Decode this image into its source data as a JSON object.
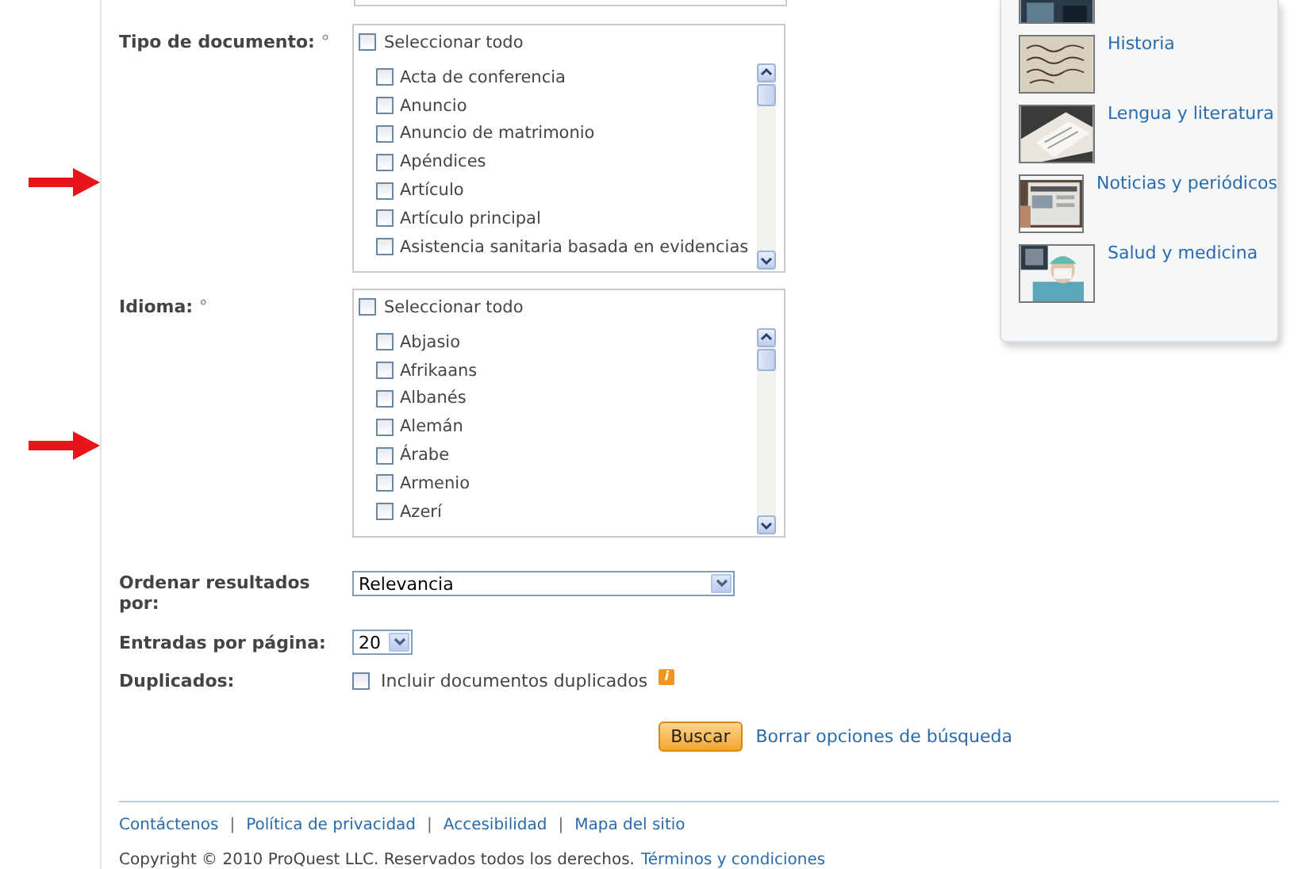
{
  "document_type": {
    "label": "Tipo de documento:",
    "marker": "°",
    "select_all": {
      "label": "Seleccionar todo",
      "checked": false
    },
    "options": [
      {
        "label": "Acta de conferencia",
        "checked": false
      },
      {
        "label": "Anuncio",
        "checked": false
      },
      {
        "label": "Anuncio de matrimonio",
        "checked": false
      },
      {
        "label": "Apéndices",
        "checked": false
      },
      {
        "label": "Artículo",
        "checked": false
      },
      {
        "label": "Artículo principal",
        "checked": false
      },
      {
        "label": "Asistencia sanitaria basada en evidencias",
        "checked": false
      }
    ]
  },
  "language": {
    "label": "Idioma:",
    "marker": "°",
    "select_all": {
      "label": "Seleccionar todo",
      "checked": false
    },
    "options": [
      {
        "label": "Abjasio",
        "checked": false
      },
      {
        "label": "Afrikaans",
        "checked": false
      },
      {
        "label": "Albanés",
        "checked": false
      },
      {
        "label": "Alemán",
        "checked": false
      },
      {
        "label": "Árabe",
        "checked": false
      },
      {
        "label": "Armenio",
        "checked": false
      },
      {
        "label": "Azerí",
        "checked": false
      }
    ]
  },
  "sort": {
    "label": "Ordenar resultados por:",
    "value": "Relevancia"
  },
  "per_page": {
    "label": "Entradas por página:",
    "value": "20"
  },
  "duplicates": {
    "label": "Duplicados:",
    "option": "Incluir documentos duplicados",
    "checked": false,
    "info": "i"
  },
  "search_button": "Buscar",
  "clear_link": "Borrar opciones de búsqueda",
  "footer_links": [
    "Contáctenos",
    "Política de privacidad",
    "Accesibilidad",
    "Mapa del sitio"
  ],
  "footer_separator": "|",
  "copyright": "Copyright © 2010 ProQuest LLC. Reservados todos los derechos.",
  "terms_link": "Términos y condiciones",
  "sidebar": {
    "categories": [
      {
        "label": "Historia",
        "kind": "picture"
      },
      {
        "label": "Lengua y literatura",
        "kind": "picture"
      },
      {
        "label": "Noticias y periódicos",
        "kind": "picture"
      },
      {
        "label": "Salud y medicina",
        "kind": "picture"
      }
    ]
  }
}
